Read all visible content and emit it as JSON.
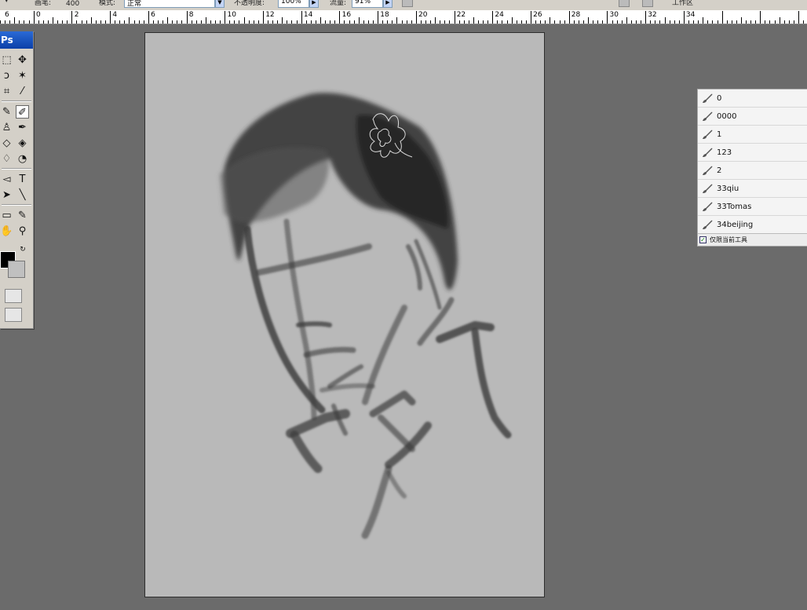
{
  "options_bar": {
    "size_value": "400",
    "mode_label": "模式:",
    "mode_value": "正常",
    "opacity_label": "不透明度:",
    "opacity_value": "100%",
    "flow_label": "流量:",
    "flow_value": "91%",
    "workspace_label": "工作区"
  },
  "ruler": {
    "labels": [
      "6",
      "0",
      "2",
      "4",
      "6",
      "8",
      "10",
      "12",
      "14",
      "16",
      "18",
      "20",
      "22",
      "24",
      "26",
      "28",
      "30",
      "32",
      "34"
    ]
  },
  "toolbox": {
    "title": "Ps"
  },
  "presets_panel": {
    "items": [
      {
        "label": "0"
      },
      {
        "label": "0000"
      },
      {
        "label": "1"
      },
      {
        "label": "123"
      },
      {
        "label": "2"
      },
      {
        "label": "33qiu"
      },
      {
        "label": "33Tomas"
      },
      {
        "label": "34beijing"
      }
    ],
    "current_tool_only_label": "仅限当前工具",
    "current_tool_only_checked": true
  },
  "colors": {
    "workspace_bg": "#6b6b6b",
    "canvas_bg": "#b9b9b9",
    "foreground": "#000000",
    "background": "#c0c0c0"
  }
}
